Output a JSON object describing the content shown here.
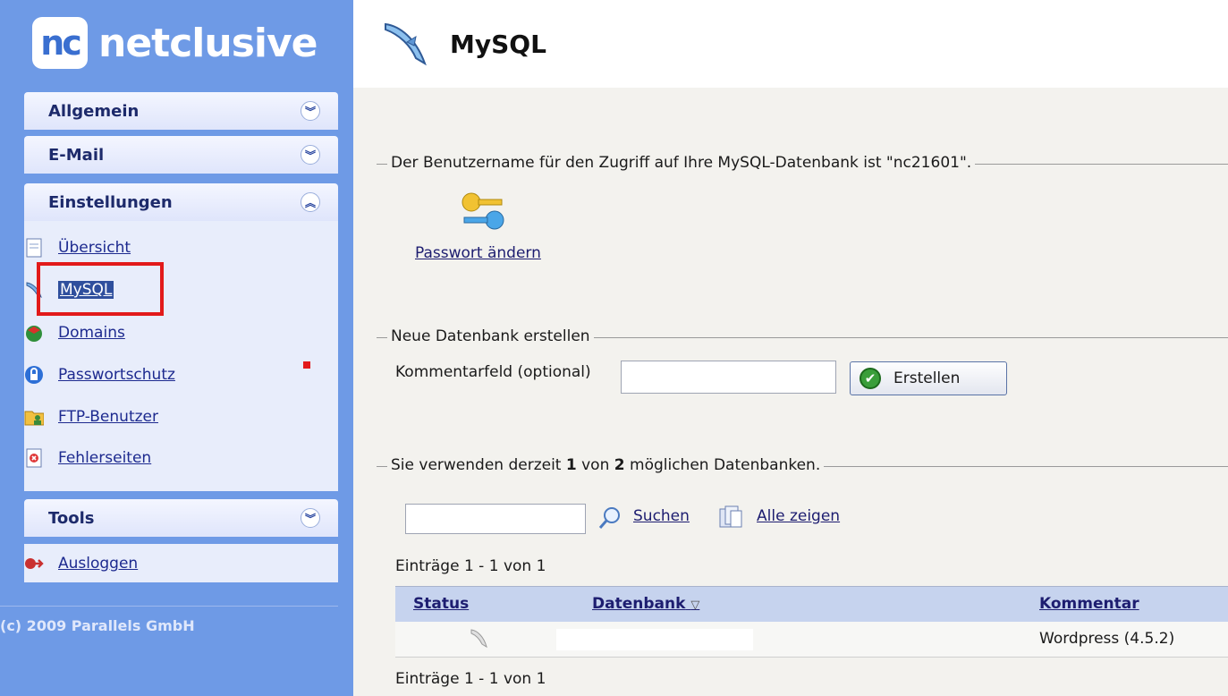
{
  "brand": {
    "logo_mark": "nc",
    "logo_word": "netclusive"
  },
  "sidebar": {
    "sections": [
      {
        "label": "Allgemein",
        "state": "collapsed"
      },
      {
        "label": "E-Mail",
        "state": "collapsed"
      },
      {
        "label": "Einstellungen",
        "state": "expanded"
      },
      {
        "label": "Tools",
        "state": "collapsed"
      }
    ],
    "settings_items": [
      {
        "label": "Übersicht",
        "icon": "page-icon"
      },
      {
        "label": "MySQL",
        "icon": "dolphin-icon",
        "selected": true
      },
      {
        "label": "Domains",
        "icon": "globe-icon"
      },
      {
        "label": "Passwortschutz",
        "icon": "lock-icon"
      },
      {
        "label": "FTP-Benutzer",
        "icon": "folder-user-icon"
      },
      {
        "label": "Fehlerseiten",
        "icon": "error-page-icon"
      }
    ],
    "logout_label": "Ausloggen",
    "copyright": "(c) 2009 Parallels GmbH"
  },
  "page": {
    "title": "MySQL"
  },
  "user_section": {
    "legend": "Der Benutzername für den Zugriff auf Ihre MySQL-Datenbank ist \"nc21601\".",
    "change_password_label": "Passwort ändern"
  },
  "new_db": {
    "legend": "Neue Datenbank erstellen",
    "comment_label": "Kommentarfeld (optional)",
    "comment_value": "",
    "create_button": "Erstellen"
  },
  "usage": {
    "legend_prefix": "Sie verwenden derzeit ",
    "used": "1",
    "legend_mid": " von ",
    "max": "2",
    "legend_suffix": " möglichen Datenbanken."
  },
  "search": {
    "value": "",
    "search_label": "Suchen",
    "show_all_label": "Alle zeigen"
  },
  "table": {
    "entries_top": "Einträge 1 - 1 von 1",
    "entries_bottom": "Einträge 1 - 1 von 1",
    "columns": [
      "Status",
      "Datenbank",
      "Kommentar"
    ],
    "sort_indicator": "▽",
    "rows": [
      {
        "datenbank": "",
        "kommentar": "Wordpress (4.5.2)"
      }
    ]
  },
  "colors": {
    "sidebar_bg": "#6e9ae6",
    "highlight": "#e21a1a",
    "content_bg": "#f3f2ee",
    "table_header": "#c6d3ee"
  }
}
